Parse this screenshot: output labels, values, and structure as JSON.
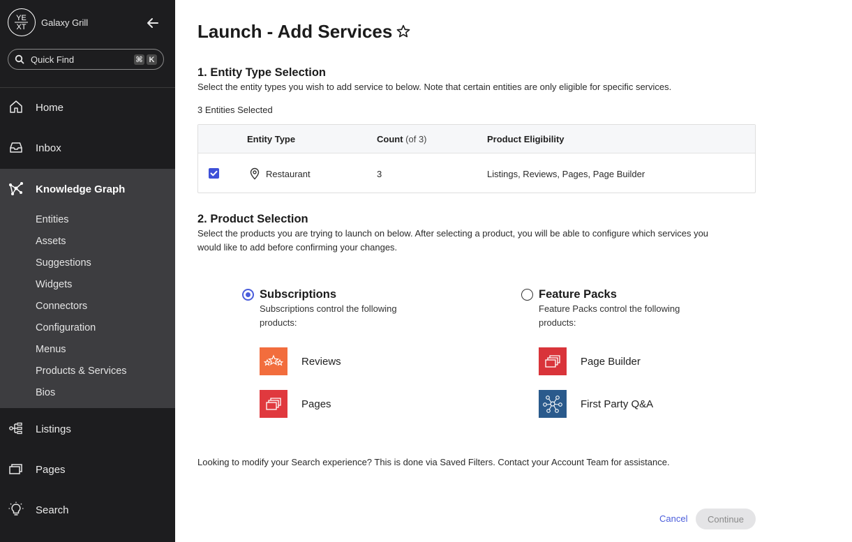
{
  "sidebar": {
    "brand_name": "Galaxy Grill",
    "logo_text_top": "YE",
    "logo_text_bottom": "XT",
    "quick_find": {
      "label": "Quick Find",
      "shortcut_modifier": "⌘",
      "shortcut_key": "K"
    },
    "nav": {
      "home": "Home",
      "inbox": "Inbox",
      "knowledge_graph": "Knowledge Graph",
      "listings": "Listings",
      "pages": "Pages",
      "search": "Search"
    },
    "kg_items": [
      "Entities",
      "Assets",
      "Suggestions",
      "Widgets",
      "Connectors",
      "Configuration",
      "Menus",
      "Products & Services",
      "Bios"
    ]
  },
  "main": {
    "title": "Launch - Add Services",
    "section1": {
      "heading": "1. Entity Type Selection",
      "description": "Select the entity types you wish to add service to below. Note that certain entities are only eligible for specific services.",
      "selected_count": "3 Entities Selected",
      "table": {
        "headers": {
          "entity_type": "Entity Type",
          "count": "Count",
          "count_suffix": "(of 3)",
          "eligibility": "Product Eligibility"
        },
        "rows": [
          {
            "checked": true,
            "entity_type": "Restaurant",
            "count": "3",
            "eligibility": "Listings, Reviews, Pages, Page Builder"
          }
        ]
      }
    },
    "section2": {
      "heading": "2. Product Selection",
      "description_line1": "Select the products you are trying to launch on below. After selecting a product, you will be able to configure which services you",
      "description_line2": "would like to add before confirming your changes.",
      "options": [
        {
          "title": "Subscriptions",
          "selected": true,
          "desc_line1": "Subscriptions control the following",
          "desc_line2": "products:",
          "products": [
            {
              "label": "Reviews",
              "icon": "reviews-stars-icon",
              "color": "#f26d3d"
            },
            {
              "label": "Pages",
              "icon": "pages-stack-icon",
              "color": "#e0393e"
            }
          ]
        },
        {
          "title": "Feature Packs",
          "selected": false,
          "desc_line1": "Feature Packs control the following",
          "desc_line2": "products:",
          "products": [
            {
              "label": "Page Builder",
              "icon": "pages-stack-icon",
              "color": "#d9343a"
            },
            {
              "label": "First Party Q&A",
              "icon": "network-nodes-icon",
              "color": "#2a5a8c"
            }
          ]
        }
      ]
    },
    "footer_note": "Looking to modify your Search experience? This is done via Saved Filters. Contact your Account Team for assistance.",
    "actions": {
      "cancel": "Cancel",
      "continue": "Continue"
    }
  },
  "colors": {
    "sidebar_bg": "#1d1d1f",
    "kg_active_bg": "#3d3d40",
    "accent": "#4b5ddb"
  }
}
